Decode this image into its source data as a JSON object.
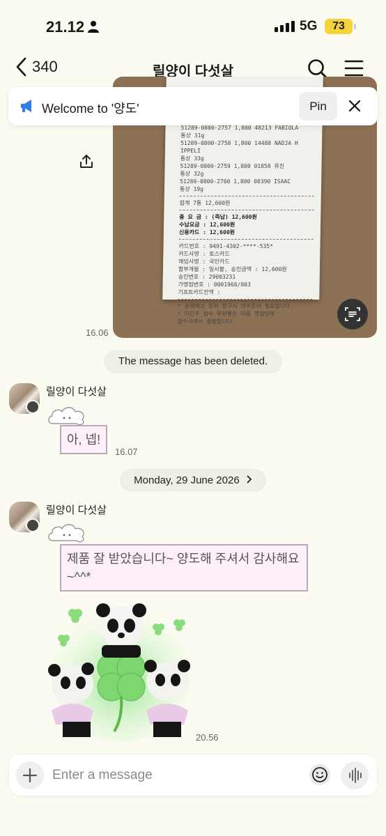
{
  "status_bar": {
    "time": "21.12",
    "network": "5G",
    "battery": "73"
  },
  "header": {
    "back_count": "340",
    "title": "릴양이 다섯살"
  },
  "notice": {
    "text": "Welcome to '양도'",
    "pin_label": "Pin"
  },
  "receipt": {
    "lines": [
      "51289-0800-2757  1,800 48213 FABIOLA",
      "  통상 31g",
      "51289-0800-2758  1,800 14488 NADJA H",
      "IPPELI",
      "  통상 33g",
      "51289-0800-2759  1,800 01858 유진",
      "  통상 32g",
      "51289-0800-2760  1,800 08390 ISAAC",
      "  통상 19g"
    ],
    "total_row": "합계        7통          12,600원",
    "pay_rows": [
      "총 요 금 :       (즉납) 12,600원",
      "수납요금 :              12,600원",
      "신용카드 :              12,600원"
    ],
    "card_rows": [
      "카드번호 : 9491-4302-****-535*",
      "카드사명 : 토스카드",
      "매입사명 : 국민카드",
      "할부개월 : 일시불, 승인금액 : 12,600원",
      "승인번호 : 29003231",
      "가맹점번호 : 0001968/803",
      "기프트카드잔액 :"
    ],
    "footer_rows": [
      "* 손해배상 등의 청구시 영수증이 필요합니다.",
      "* 미간주 접수 우편물은 다음 영업일에",
      "  접수국에서 출발합니다."
    ]
  },
  "messages": {
    "photo_time": "16.06",
    "deleted_notice": "The message has been deleted.",
    "sender_name": "릴양이 다섯살",
    "reply_1": "아, 넵!",
    "reply_1_time": "16.07",
    "date_divider": "Monday, 29 June 2026",
    "sender_name_2": "릴양이 다섯살",
    "reply_2": "제품 잘 받았습니다~ 양도해 주셔서 감사해요 ~^^*",
    "sticker_time": "20.56"
  },
  "input_bar": {
    "placeholder": "Enter a message"
  },
  "colors": {
    "background": "#fbfbf1",
    "bubble_bg": "#fdeff7",
    "bubble_border": "#b7a9b9",
    "notice_icon": "#2f7fe6",
    "battery": "#f6d33a"
  },
  "icons": [
    "person-icon",
    "back-chevron-icon",
    "search-icon",
    "menu-icon",
    "megaphone-icon",
    "close-icon",
    "share-icon",
    "text-scan-icon",
    "plus-icon",
    "emoji-icon",
    "voice-wave-icon",
    "chevron-right-icon"
  ]
}
